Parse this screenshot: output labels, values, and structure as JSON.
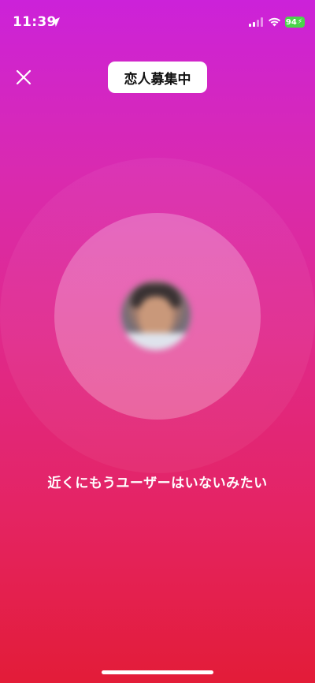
{
  "status_bar": {
    "time": "11:39",
    "battery_level": "94",
    "location_icon": "location-arrow-icon",
    "signal_icon": "cellular-signal-icon",
    "wifi_icon": "wifi-icon",
    "battery_color": "#4bd34b"
  },
  "header": {
    "title": "恋人募集中",
    "close_icon": "close-icon"
  },
  "main": {
    "avatar_description": "avatar",
    "empty_message": "近くにもうユーザーはいないみたい"
  },
  "colors": {
    "gradient_top": "#cc22d9",
    "gradient_bottom": "#e31c38",
    "title_pill_bg": "#ffffff"
  }
}
